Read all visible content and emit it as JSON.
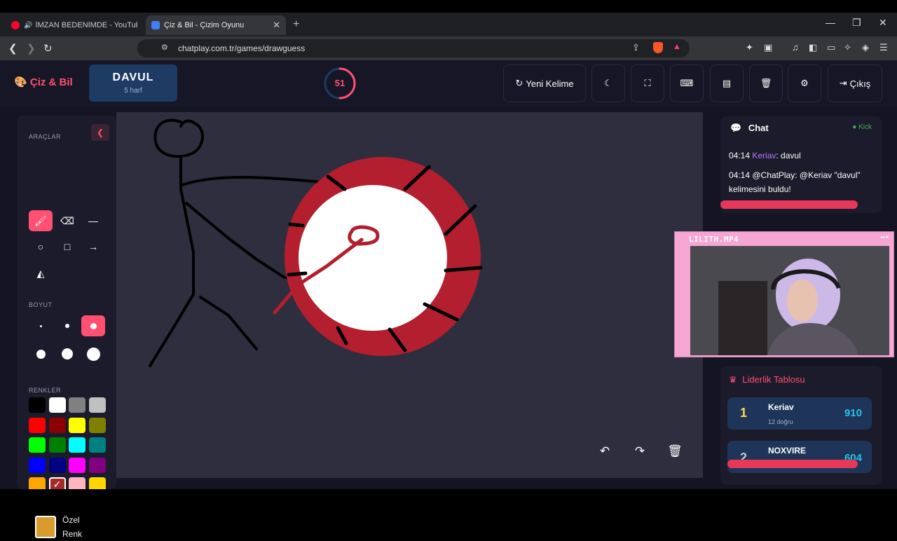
{
  "browser": {
    "tabs": [
      {
        "title": "İMZAN BEDENİMDE - YouTube M",
        "active": false
      },
      {
        "title": "Çiz & Bil - Çizim Oyunu",
        "active": true
      }
    ],
    "new_tab": "+",
    "url": "chatplay.com.tr/games/drawguess"
  },
  "header": {
    "brand": "Çiz & Bil",
    "word": "DAVUL",
    "word_hint": "5 harf",
    "timer": "51",
    "timer_progress": 0.5,
    "buttons": {
      "new_word": "Yeni Kelime",
      "exit": "Çıkış"
    }
  },
  "tools": {
    "section_tools": "ARAÇLAR",
    "section_size": "BOYUT",
    "section_colors": "RENKLER",
    "selected_tool": "brush",
    "colors": [
      "#000000",
      "#ffffff",
      "#808080",
      "#c0c0c0",
      "#ff0000",
      "#8b0000",
      "#ffff00",
      "#808000",
      "#00ff00",
      "#008000",
      "#00ffff",
      "#008080",
      "#0000ff",
      "#000080",
      "#ff00ff",
      "#800080",
      "#ffa500",
      "#a52a2a",
      "#ffb6c1",
      "#ffd700"
    ],
    "selected_color": "#a52a2a",
    "custom_color_label": "Özel Renk",
    "custom_color": "#d89b2e"
  },
  "chat": {
    "title": "Chat",
    "platform": "Kick",
    "messages": [
      {
        "time": "04:14",
        "user": "Keriav",
        "text": ": davul"
      },
      {
        "time": "04:14",
        "user": "@ChatPlay",
        "text": ": @Keriav \"davul\" kelimesini buldu!"
      }
    ]
  },
  "webcam": {
    "title": "LILITH.MP4"
  },
  "leaderboard": {
    "title": "Liderlik Tablosu",
    "rows": [
      {
        "rank": "1",
        "name": "Keriav",
        "sub": "12 doğru",
        "score": "910"
      },
      {
        "rank": "2",
        "name": "NOXVIRE",
        "sub": "",
        "score": "604"
      }
    ]
  }
}
